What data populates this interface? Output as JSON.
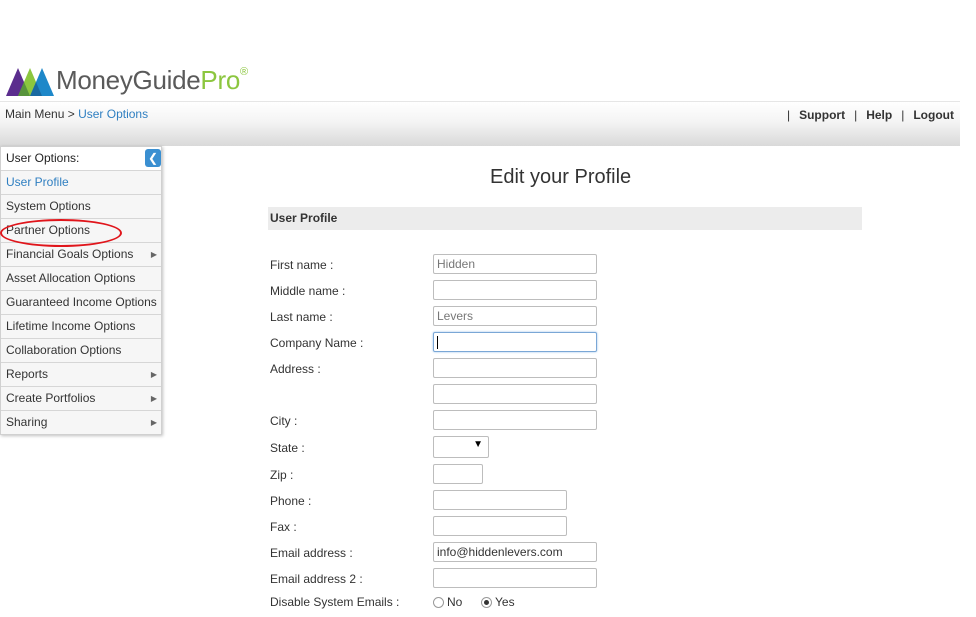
{
  "logo": {
    "text_main": "MoneyGuide",
    "text_pro": "Pro",
    "mark": "®"
  },
  "breadcrumb": {
    "root": "Main Menu",
    "separator": ">",
    "current": "User Options"
  },
  "top_links": {
    "support": "Support",
    "help": "Help",
    "logout": "Logout",
    "separator": "|"
  },
  "sidebar": {
    "header": "User Options:",
    "collapse_glyph": "❮",
    "items": [
      {
        "label": "User Profile",
        "active": true,
        "submenu": false
      },
      {
        "label": "System Options",
        "submenu": false
      },
      {
        "label": "Partner Options",
        "submenu": false
      },
      {
        "label": "Financial Goals Options",
        "submenu": true
      },
      {
        "label": "Asset Allocation Options",
        "submenu": false
      },
      {
        "label": "Guaranteed Income Options",
        "submenu": false
      },
      {
        "label": "Lifetime Income Options",
        "submenu": false
      },
      {
        "label": "Collaboration Options",
        "submenu": false
      },
      {
        "label": "Reports",
        "submenu": true
      },
      {
        "label": "Create Portfolios",
        "submenu": true
      },
      {
        "label": "Sharing",
        "submenu": true
      }
    ],
    "submenu_arrow": "▶"
  },
  "main": {
    "title": "Edit your Profile",
    "section": "User Profile",
    "fields": {
      "first_name": {
        "label": "First name :",
        "value": "Hidden"
      },
      "middle_name": {
        "label": "Middle name :",
        "value": ""
      },
      "last_name": {
        "label": "Last name :",
        "value": "Levers"
      },
      "company": {
        "label": "Company Name :",
        "value": ""
      },
      "address": {
        "label": "Address :",
        "value": "",
        "value2": ""
      },
      "city": {
        "label": "City :",
        "value": ""
      },
      "state": {
        "label": "State :",
        "value": "",
        "arrow": "▼"
      },
      "zip": {
        "label": "Zip :",
        "value": ""
      },
      "phone": {
        "label": "Phone :",
        "value": ""
      },
      "fax": {
        "label": "Fax :",
        "value": ""
      },
      "email": {
        "label": "Email address :",
        "value": "info@hiddenlevers.com"
      },
      "email2": {
        "label": "Email address 2 :",
        "value": ""
      },
      "disable_emails": {
        "label": "Disable System Emails :",
        "option_no": "No",
        "option_yes": "Yes",
        "selected": "Yes"
      }
    }
  },
  "colors": {
    "accent_blue": "#2f7fc1",
    "logo_green": "#8cc63f",
    "highlight_red": "#e0151b"
  }
}
